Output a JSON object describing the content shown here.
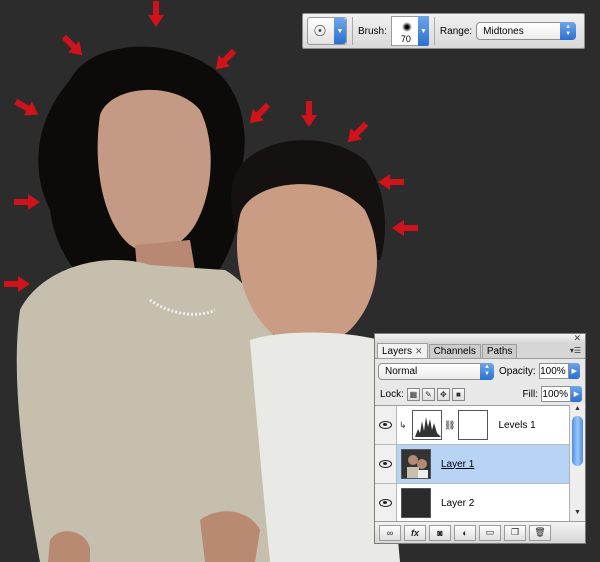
{
  "options_bar": {
    "brush_label": "Brush:",
    "brush_size": "70",
    "range_label": "Range:",
    "range_value": "Midtones"
  },
  "layers_panel": {
    "tabs": [
      {
        "label": "Layers",
        "active": true
      },
      {
        "label": "Channels",
        "active": false
      },
      {
        "label": "Paths",
        "active": false
      }
    ],
    "blend_mode": "Normal",
    "opacity_label": "Opacity:",
    "opacity_value": "100%",
    "lock_label": "Lock:",
    "fill_label": "Fill:",
    "fill_value": "100%",
    "layers": [
      {
        "name": "Levels 1",
        "visible": true,
        "selected": false
      },
      {
        "name": "Layer 1",
        "visible": true,
        "selected": true
      },
      {
        "name": "Layer 2",
        "visible": true,
        "selected": false
      }
    ],
    "footer_fx": "fx"
  },
  "colors": {
    "canvas_bg": "#2c2c2c",
    "arrow": "#d0121b",
    "selection": "#b7d3f5",
    "accent_blue": "#2b6fd0"
  },
  "icons": {
    "tool": "dodge-tool-icon",
    "eye": "eye-icon",
    "lock": [
      "lock-transparent-icon",
      "lock-brush-icon",
      "lock-move-icon",
      "lock-all-icon"
    ],
    "footer": [
      "link-icon",
      "fx-icon",
      "mask-icon",
      "adjustment-icon",
      "folder-icon",
      "new-layer-icon",
      "trash-icon"
    ]
  }
}
